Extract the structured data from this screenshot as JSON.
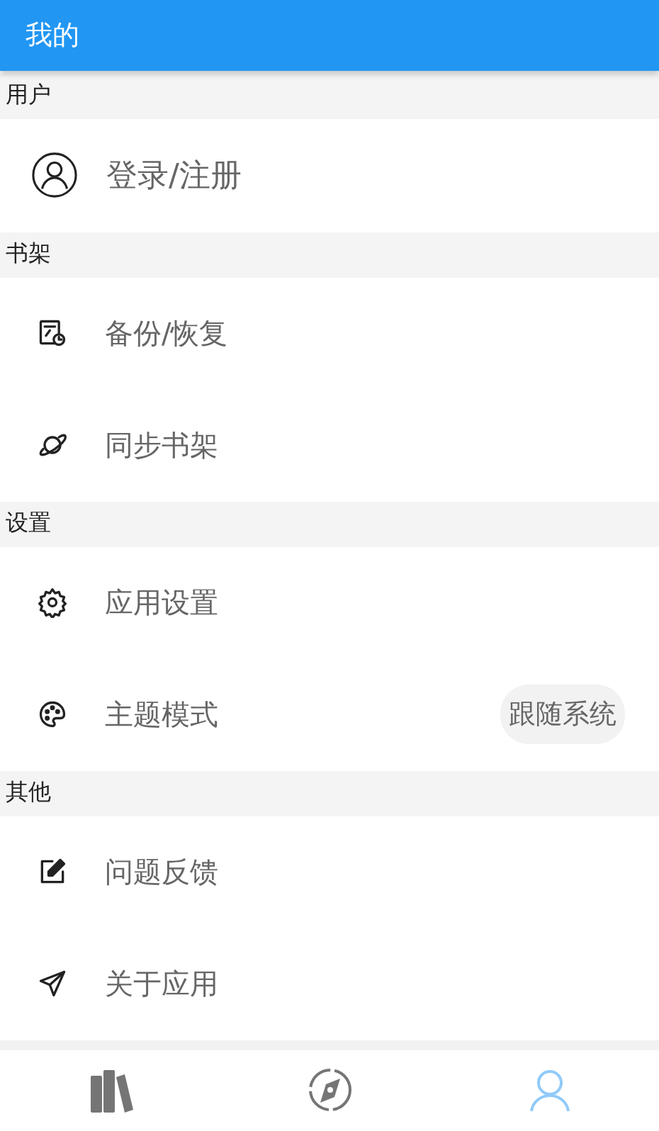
{
  "app_bar": {
    "title": "我的"
  },
  "sections": [
    {
      "title": "用户",
      "items": [
        {
          "label": "登录/注册",
          "kind": "account"
        }
      ]
    },
    {
      "title": "书架",
      "items": [
        {
          "label": "备份/恢复",
          "kind": "plain"
        },
        {
          "label": "同步书架",
          "kind": "plain"
        }
      ]
    },
    {
      "title": "设置",
      "items": [
        {
          "label": "应用设置",
          "kind": "plain"
        },
        {
          "label": "主题模式",
          "kind": "plain",
          "value": "跟随系统"
        }
      ]
    },
    {
      "title": "其他",
      "items": [
        {
          "label": "问题反馈",
          "kind": "plain"
        },
        {
          "label": "关于应用",
          "kind": "plain"
        }
      ]
    }
  ],
  "bottom_nav": [
    {
      "selected": false
    },
    {
      "selected": false
    },
    {
      "selected": true
    }
  ]
}
